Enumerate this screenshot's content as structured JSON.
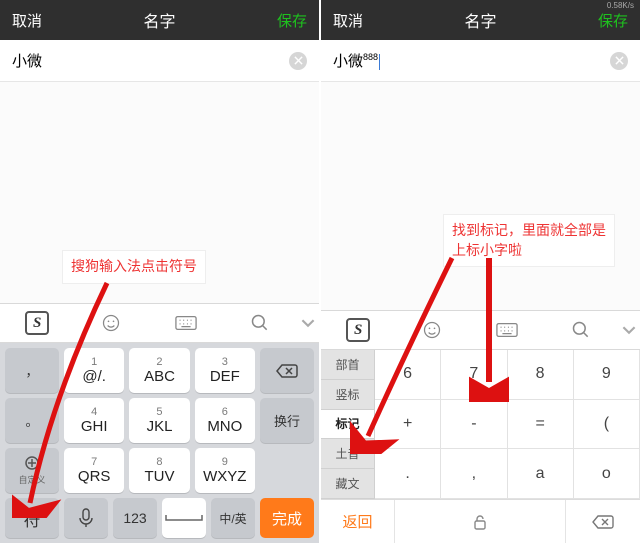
{
  "header": {
    "cancel": "取消",
    "title": "名字",
    "save": "保存",
    "net_speed": "0.58K/s"
  },
  "left": {
    "input_value": "小微",
    "annotation": "搜狗输入法点击符号",
    "t9": {
      "keys": [
        {
          "n": "1",
          "l": "@/."
        },
        {
          "n": "2",
          "l": "ABC"
        },
        {
          "n": "3",
          "l": "DEF"
        },
        {
          "n": "4",
          "l": "GHI"
        },
        {
          "n": "5",
          "l": "JKL"
        },
        {
          "n": "6",
          "l": "MNO"
        },
        {
          "n": "7",
          "l": "QRS"
        },
        {
          "n": "8",
          "l": "TUV"
        },
        {
          "n": "9",
          "l": "WXYZ"
        }
      ],
      "side_left": [
        "，",
        "。",
        "？"
      ],
      "side_left_custom": "自定义",
      "side_right": [
        "",
        "换行",
        ""
      ],
      "bottom": {
        "sym": "符",
        "num": "123",
        "space": "␣",
        "lang": "中/英",
        "done": "完成"
      }
    }
  },
  "right": {
    "input_value": "小微",
    "input_super": "888",
    "annotation": "找到标记，里面就全部是上标小字啦",
    "sym": {
      "cats": [
        "部首",
        "竖标",
        "标记",
        "土音",
        "藏文"
      ],
      "active_index": 2,
      "grid": [
        "6",
        "7",
        "8",
        "9",
        "+",
        "-",
        "=",
        "(",
        ".",
        ",",
        "a",
        "o"
      ],
      "bottom": {
        "ret": "返回"
      }
    }
  },
  "toolbar_icons": [
    "logo",
    "smile",
    "keyboard",
    "search",
    "chev"
  ]
}
